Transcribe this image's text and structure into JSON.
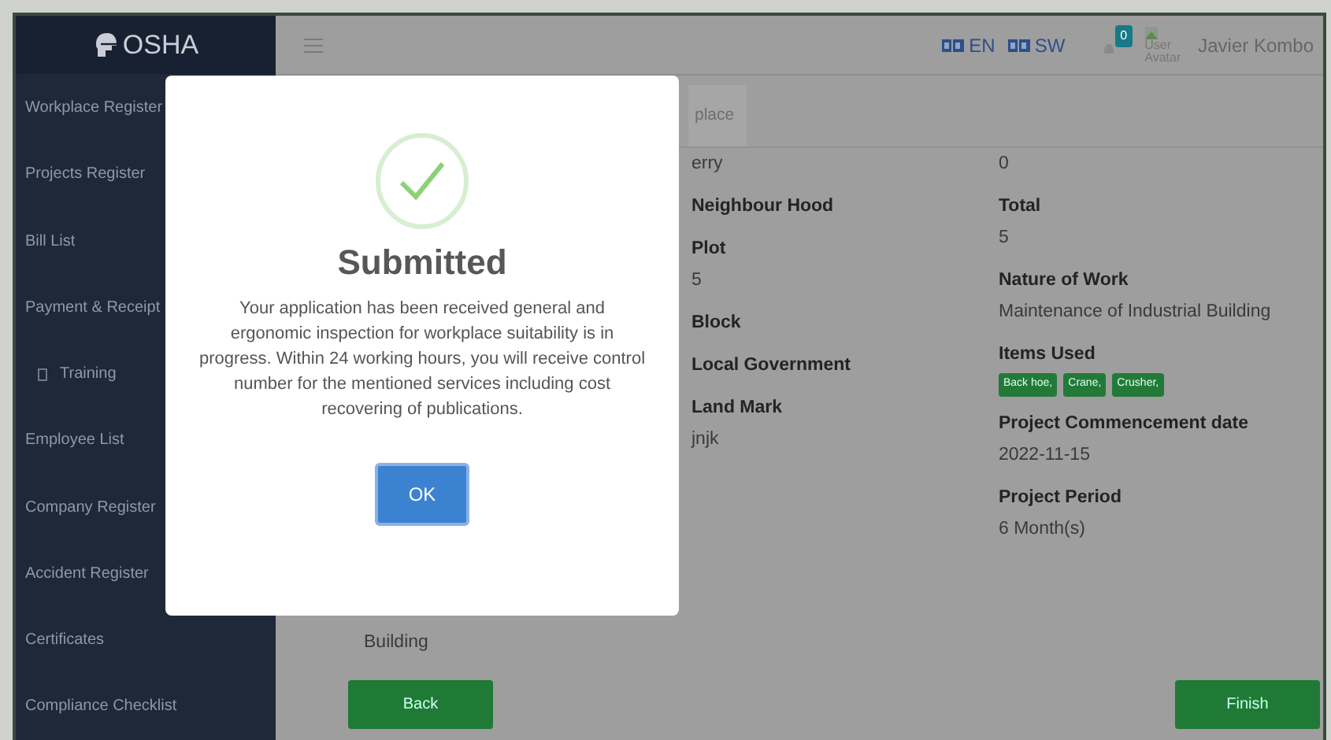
{
  "app": {
    "logo": "OSHA"
  },
  "sidebar": {
    "items": [
      {
        "label": "Workplace Register",
        "kind": "plain"
      },
      {
        "label": "Projects Register",
        "kind": "plain"
      },
      {
        "label": "Bill List",
        "kind": "plain"
      },
      {
        "label": "Payment & Receipt",
        "kind": "plain"
      },
      {
        "label": "Training",
        "kind": "with-icon"
      },
      {
        "label": "Employee List",
        "kind": "plain"
      },
      {
        "label": "Company Register",
        "kind": "plain"
      },
      {
        "label": "Accident Register",
        "kind": "plain"
      },
      {
        "label": "Certificates",
        "kind": "plain"
      },
      {
        "label": "Compliance Checklist",
        "kind": "plain"
      }
    ]
  },
  "topbar": {
    "languages": [
      {
        "label": "EN"
      },
      {
        "label": "SW"
      }
    ],
    "notification_count": "0",
    "avatar_alt": "User Avatar",
    "user_name": "Javier Kombo"
  },
  "tabs": [
    {
      "label": "place",
      "selected": true
    }
  ],
  "details": {
    "left": [
      {
        "kind": "value",
        "text": "erry"
      },
      {
        "kind": "label",
        "text": "Neighbour Hood"
      },
      {
        "kind": "label",
        "text": "Plot"
      },
      {
        "kind": "value",
        "text": "5"
      },
      {
        "kind": "label",
        "text": "Block"
      },
      {
        "kind": "label",
        "text": "Local Government"
      },
      {
        "kind": "label",
        "text": "Land Mark"
      },
      {
        "kind": "value",
        "text": "jnjk"
      }
    ],
    "right": [
      {
        "kind": "value",
        "text": "0"
      },
      {
        "kind": "label",
        "text": "Total"
      },
      {
        "kind": "value",
        "text": "5"
      },
      {
        "kind": "label",
        "text": "Nature of Work"
      },
      {
        "kind": "value",
        "text": "Maintenance of Industrial Building"
      },
      {
        "kind": "label",
        "text": "Items Used"
      },
      {
        "kind": "tags",
        "tags": [
          "Back hoe,",
          "Crane,",
          "Crusher,"
        ]
      },
      {
        "kind": "label",
        "text": "Project Commencement date"
      },
      {
        "kind": "value",
        "text": "2022-11-15"
      },
      {
        "kind": "label",
        "text": "Project Period"
      },
      {
        "kind": "value",
        "text": "6 Month(s)"
      }
    ],
    "bottom_value": "Building"
  },
  "buttons": {
    "back": "Back",
    "finish": "Finish"
  },
  "modal": {
    "title": "Submitted",
    "message": "Your application has been received general and ergonomic inspection for workplace suitability is in progress. Within 24 working hours, you will receive control number for the mentioned services including cost recovering of publications.",
    "button": "OK"
  }
}
